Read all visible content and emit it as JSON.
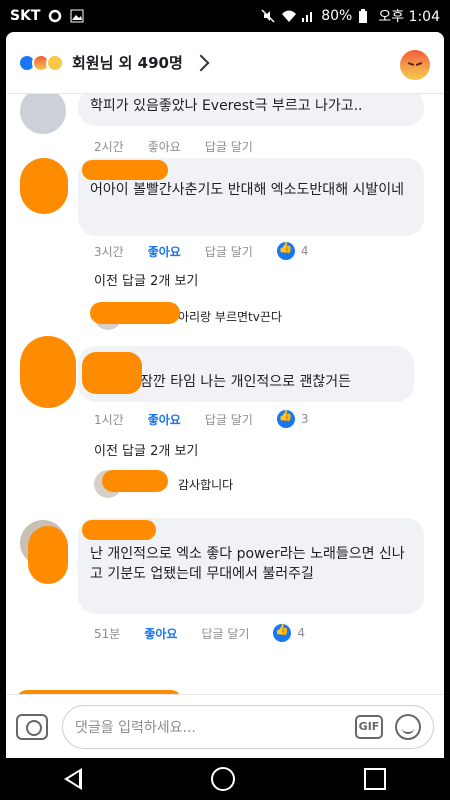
{
  "status": {
    "carrier": "SKT",
    "battery": "80%",
    "time": "오후 1:04"
  },
  "header": {
    "reaction_count": "회원님 외 490명"
  },
  "comments": [
    {
      "text": "학피가 있음좋았나 Everest극 부르고 나가고..",
      "time": "2시간",
      "like": "좋아요",
      "reply": "답글 달기"
    },
    {
      "text": "어아이 볼빨간사춘기도 반대해 엑소도반대해 시발이네",
      "time": "3시간",
      "like": "좋아요",
      "reply": "답글 달기",
      "like_count": "4",
      "more_replies": "이전 답글 2개 보기",
      "preview_reply": "아리랑 부르면tv끈다"
    },
    {
      "text": "잠깐 타임 나는 개인적으로 괜찮거든",
      "time": "1시간",
      "like": "좋아요",
      "reply": "답글 달기",
      "like_count": "3",
      "more_replies": "이전 답글 2개 보기",
      "preview_reply": "감사합니다"
    },
    {
      "text": "난 개인적으로 엑소 좋다 power라는 노래들으면 신나고 기분도 업됐는데 무대에서 불러주길",
      "time": "51분",
      "like": "좋아요",
      "reply": "답글 달기",
      "like_count": "4"
    }
  ],
  "composer": {
    "placeholder": "댓글을 입력하세요...",
    "gif": "GIF"
  },
  "colors": {
    "accent": "#1877f2",
    "redaction": "#ff8c00"
  }
}
